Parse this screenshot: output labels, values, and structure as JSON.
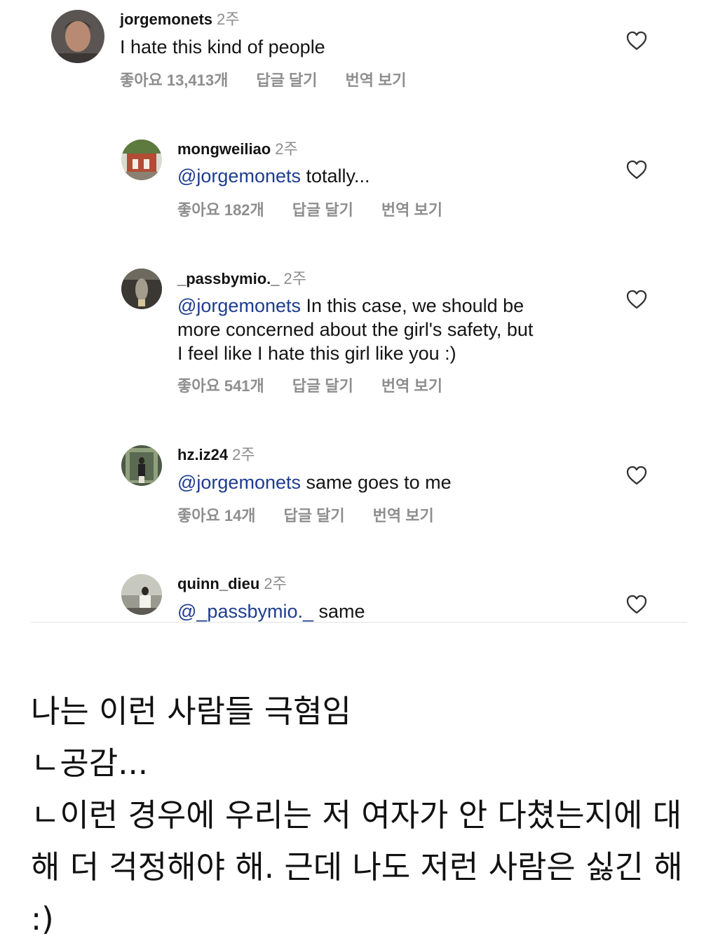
{
  "comments": [
    {
      "username": "jorgemonets",
      "time": "2주",
      "mention": "",
      "text": "I hate this kind of people",
      "likes": "좋아요 13,413개",
      "reply": "답글 달기",
      "translate": "번역 보기"
    },
    {
      "username": "mongweiliao",
      "time": "2주",
      "mention": "@jorgemonets",
      "text": " totally...",
      "likes": "좋아요 182개",
      "reply": "답글 달기",
      "translate": "번역 보기"
    },
    {
      "username": "_passbymio._",
      "time": "2주",
      "mention": "@jorgemonets",
      "lines": [
        " In this case, we should be",
        "more concerned about the girl's safety, but",
        "I feel like I hate this girl like you :)"
      ],
      "likes": "좋아요 541개",
      "reply": "답글 달기",
      "translate": "번역 보기"
    },
    {
      "username": "hz.iz24",
      "time": "2주",
      "mention": "@jorgemonets",
      "text": " same goes to me",
      "likes": "좋아요 14개",
      "reply": "답글 달기",
      "translate": "번역 보기"
    },
    {
      "username": "quinn_dieu",
      "time": "2주",
      "mention": "@_passbymio._",
      "text": " same"
    }
  ],
  "icons": {
    "like": "heart-outline-icon"
  },
  "colors": {
    "mention": "#1e3d8f",
    "meta": "#8e8e8e"
  },
  "caption": [
    "나는 이런 사람들 극혐임",
    "ㄴ공감...",
    "ㄴ이런 경우에 우리는 저 여자가 안 다쳤는지에 대",
    "해 더 걱정해야 해. 근데 나도 저런 사람은 싫긴 해",
    ":)"
  ]
}
